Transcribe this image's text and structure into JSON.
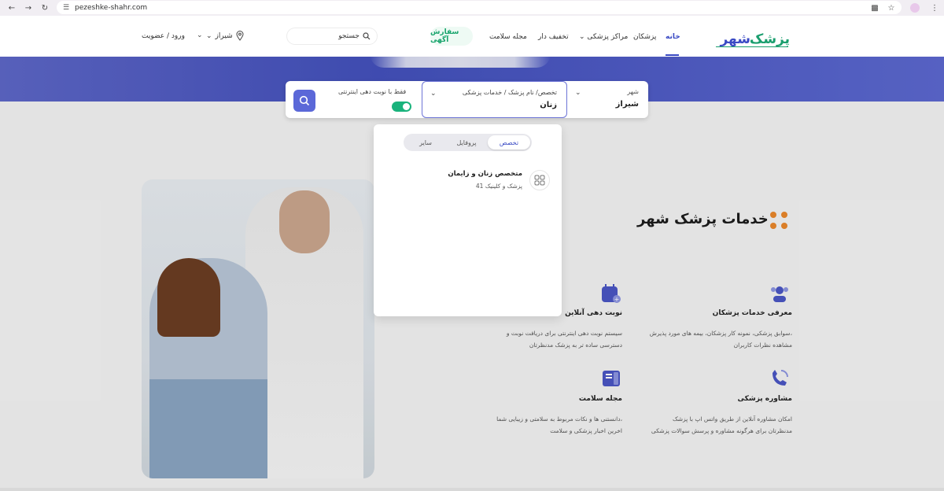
{
  "browser": {
    "url": "pezeshke-shahr.com",
    "nav_icons": [
      "back-icon",
      "forward-icon",
      "reload-icon"
    ],
    "right_icons": [
      "translate-icon",
      "star-icon",
      "profile-icon",
      "menu-icon"
    ]
  },
  "header": {
    "logo_text": "پزشک شهر",
    "nav": {
      "home": "خانه",
      "doctors": "پزشکان",
      "centers": "مراکز پزشکی",
      "discount": "تخفیف دار",
      "magazine": "مجله سلامت"
    },
    "ad_button": "سفارش آگهی",
    "search_placeholder": "جستجو",
    "city": "شیراز",
    "login": "ورود / عضویت",
    "accent": "#3a4ac4"
  },
  "searchbar": {
    "city_label": "شهر",
    "city_value": "شیراز",
    "spec_placeholder": "تخصص/ نام پزشک / خدمات پزشکی",
    "spec_value": "زنان",
    "toggle_label": "فقط با نوبت دهی اینترنتی",
    "toggle_on": true,
    "toggle_color": "#1ab37c"
  },
  "dropdown": {
    "tabs": [
      "تخصص",
      "پروفایل",
      "سایر"
    ],
    "active_tab": "تخصص",
    "results": [
      {
        "title": "متخصص زنان و زایمان",
        "subtitle": "پزشک و کلینیک 41"
      }
    ]
  },
  "services": {
    "title": "خدمات پزشک شهر",
    "items": [
      {
        "title": "معرفی خدمات پزشکان",
        "desc1": "سوابق پزشکی، نمونه کار پزشکان، بیمه های مورد پذیرش،",
        "desc2": "مشاهده نظرات کاربران"
      },
      {
        "title": "نوبت دهی آنلاین",
        "desc1": "سیستم نوبت دهی اینترنتی برای دریافت نوبت و",
        "desc2": "دسترسی ساده تر به پزشک مدنظرتان"
      },
      {
        "title": "مشاوره پزشکی",
        "desc1": "امکان مشاوره آنلاین از طریق واتس اپ با پزشک",
        "desc2": "مدنظرتان برای هرگونه مشاوره و پرسش سوالات پزشکی"
      },
      {
        "title": "مجله سلامت",
        "desc1": "دانستنی ها و نکات مربوط به سلامتی و زیبایی شما،",
        "desc2": "اخرین اخبار پزشکی و سلامت"
      }
    ]
  }
}
